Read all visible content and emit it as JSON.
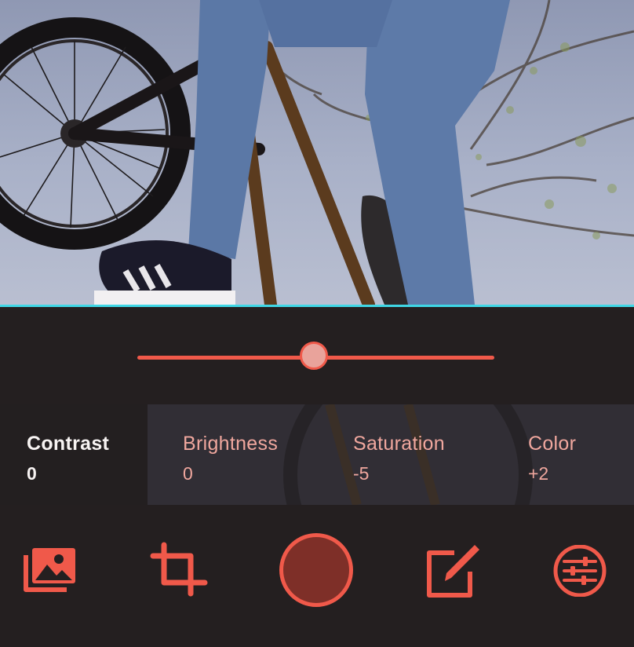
{
  "colors": {
    "accent": "#f0594a",
    "background": "#231f20",
    "active_text": "#f7f3f2",
    "inactive_text": "#f0a79e",
    "thumb_fill": "#e9a39b",
    "record_fill": "#7e2f28",
    "preview_divider": "#3fd7e6"
  },
  "preview": {
    "subject": "bmx-rider-photo"
  },
  "slider": {
    "value_fraction": 0.5
  },
  "adjustments": [
    {
      "label": "Contrast",
      "value": "0",
      "active": true
    },
    {
      "label": "Brightness",
      "value": "0",
      "active": false
    },
    {
      "label": "Saturation",
      "value": "-5",
      "active": false
    },
    {
      "label": "Color",
      "value": "+2",
      "active": false
    }
  ],
  "toolbar": {
    "icons": [
      "gallery-icon",
      "crop-icon",
      "record-button",
      "edit-icon",
      "filters-icon"
    ]
  }
}
